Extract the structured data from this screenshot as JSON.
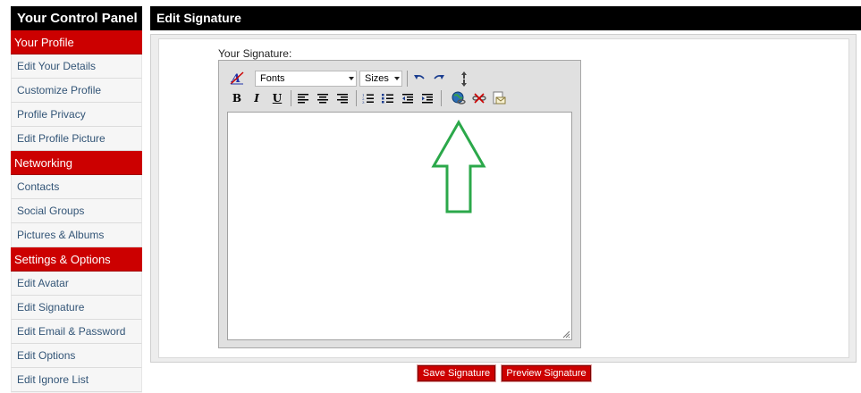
{
  "sidebar": {
    "title": "Your Control Panel",
    "sections": [
      {
        "header": "Your Profile",
        "items": [
          "Edit Your Details",
          "Customize Profile",
          "Profile Privacy",
          "Edit Profile Picture"
        ]
      },
      {
        "header": "Networking",
        "items": [
          "Contacts",
          "Social Groups",
          "Pictures & Albums"
        ]
      },
      {
        "header": "Settings & Options",
        "items": [
          "Edit Avatar",
          "Edit Signature",
          "Edit Email & Password",
          "Edit Options",
          "Edit Ignore List"
        ]
      }
    ]
  },
  "main": {
    "title": "Edit Signature",
    "signature_label": "Your Signature:",
    "editor": {
      "font_select": "Fonts",
      "size_select": "Sizes",
      "bold": "B",
      "italic": "I",
      "underline": "U",
      "value": ""
    },
    "buttons": {
      "save": "Save Signature",
      "preview": "Preview Signature"
    }
  },
  "colors": {
    "section_red": "#cc0000",
    "header_black": "#000000",
    "link_blue": "#335577",
    "annotation_green": "#2ba84a"
  }
}
